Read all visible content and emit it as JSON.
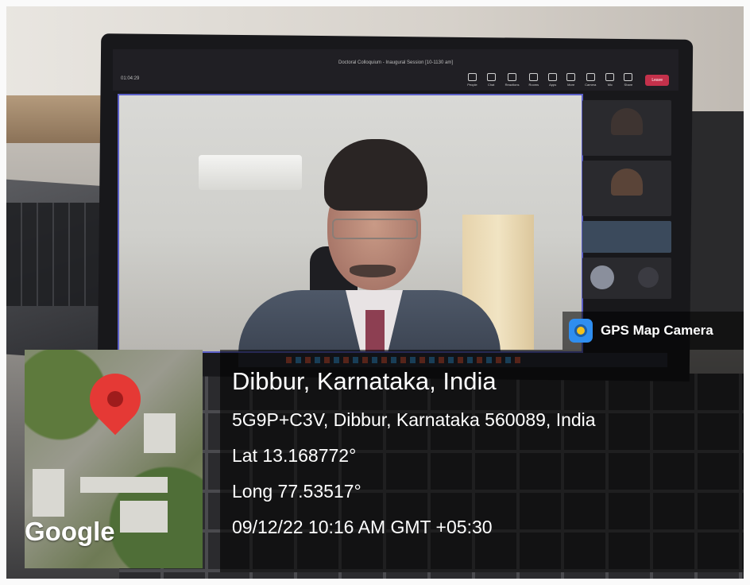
{
  "meeting": {
    "title": "Doctoral Colloquium - Inaugural Session [10-1130 am]",
    "timer": "01:04:29",
    "tools": [
      "People",
      "Chat",
      "Reactions",
      "Rooms",
      "Apps",
      "More",
      "Camera",
      "Mic",
      "Share"
    ],
    "leave_label": "Leave"
  },
  "overlay": {
    "app_name": "GPS Map Camera",
    "location_title": "Dibbur, Karnataka, India",
    "address": "5G9P+C3V, Dibbur, Karnataka 560089, India",
    "latitude": "Lat 13.168772°",
    "longitude": "Long 77.53517°",
    "datetime": "09/12/22 10:16 AM GMT +05:30",
    "map_brand": "Google"
  },
  "colors": {
    "pin": "#e53935",
    "overlay_bg": "rgba(0,0,0,0.58)",
    "leave": "#c4314b",
    "logo_blue": "#2f8ef0",
    "logo_yellow": "#f4c21c"
  }
}
